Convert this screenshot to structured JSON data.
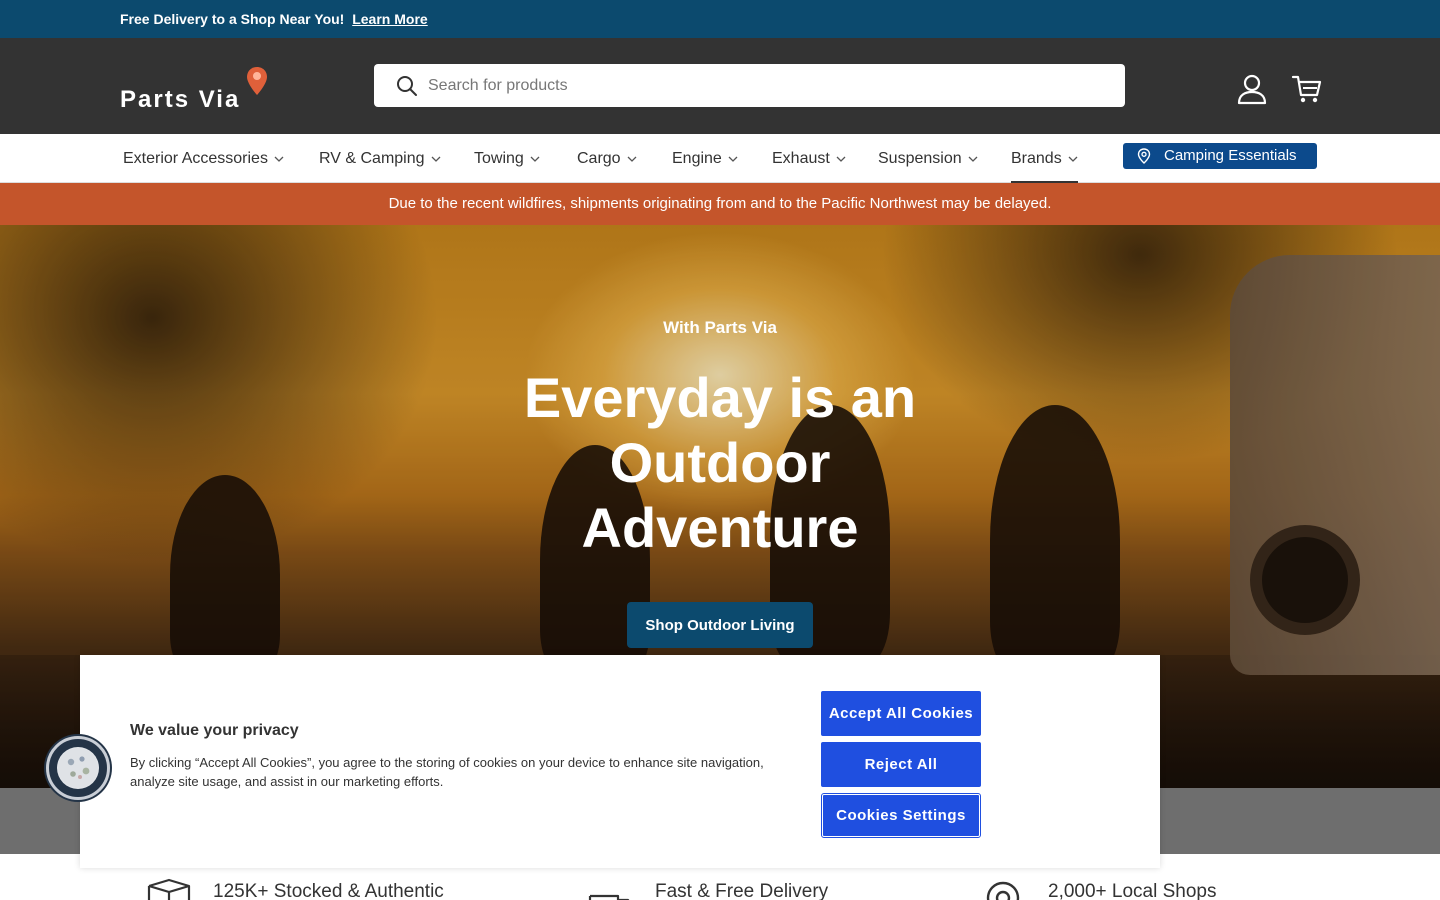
{
  "announcement": {
    "text": "Free Delivery to a Shop Near You!",
    "link": "Learn More"
  },
  "header": {
    "logo_text": "Parts Via",
    "search_placeholder": "Search for products",
    "account_icon": "user-icon",
    "cart_icon": "cart-icon"
  },
  "nav": {
    "items": [
      {
        "label": "Exterior Accessories"
      },
      {
        "label": "RV & Camping"
      },
      {
        "label": "Towing"
      },
      {
        "label": "Cargo"
      },
      {
        "label": "Engine"
      },
      {
        "label": "Exhaust"
      },
      {
        "label": "Suspension"
      },
      {
        "label": "Brands"
      }
    ],
    "active_label": "Brands",
    "highlight_button": "Camping Essentials"
  },
  "alert": {
    "text": "Due to the recent wildfires, shipments originating from and to the Pacific Northwest may be delayed."
  },
  "hero": {
    "subtitle": "With Parts Via",
    "title": "Everyday is an Outdoor Adventure",
    "cta": "Shop Outdoor Living"
  },
  "features": [
    {
      "label": "125K+ Stocked & Authentic",
      "icon": "box-icon"
    },
    {
      "label": "Fast & Free Delivery",
      "icon": "truck-icon"
    },
    {
      "label": "2,000+ Local Shops",
      "icon": "location-icon"
    }
  ],
  "cookie_banner": {
    "title": "We value your privacy",
    "body": "By clicking “Accept All Cookies”, you agree to the storing of cookies on your device to enhance site navigation, analyze site usage, and assist in our marketing efforts.",
    "accept": "Accept All Cookies",
    "reject": "Reject All",
    "settings": "Cookies Settings"
  },
  "colors": {
    "announcement_bg": "#0c4a6e",
    "header_bg": "#333333",
    "alert_bg": "#c4552b",
    "cookie_button": "#1f4fe0",
    "camping_button": "#0c4a8c"
  }
}
